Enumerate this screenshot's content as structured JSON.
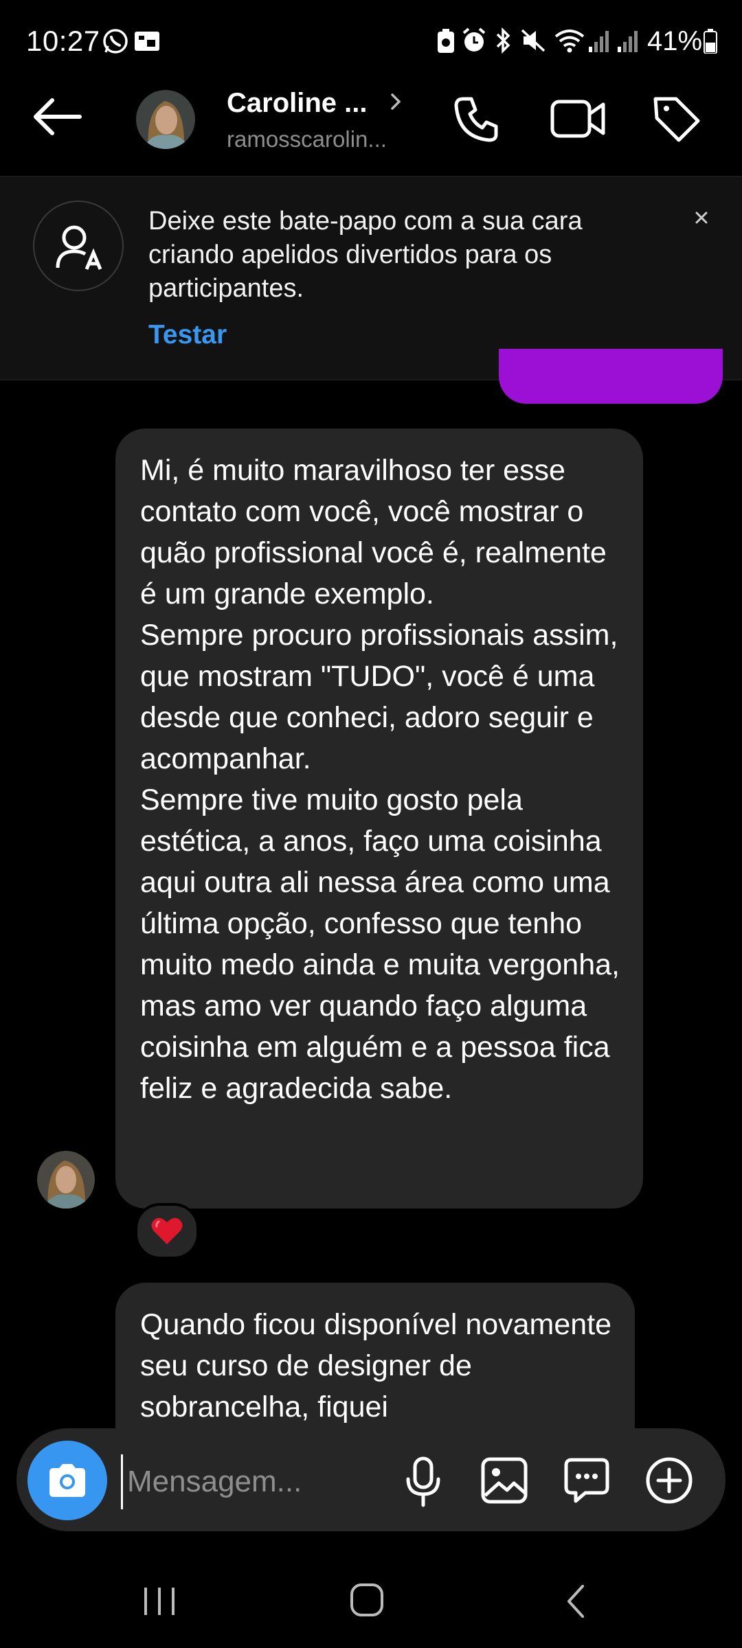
{
  "status_bar": {
    "time": "10:27",
    "battery": "41%",
    "icons": [
      "whatsapp-icon",
      "media-icon",
      "battery-saver-icon",
      "alarm-icon",
      "bluetooth-icon",
      "mute-icon",
      "wifi-icon",
      "signal-icon",
      "signal-icon",
      "battery-icon"
    ]
  },
  "header": {
    "contact_name": "Caroline ...",
    "contact_username": "ramosscarolin...",
    "icons": [
      "back-arrow-icon",
      "chevron-right-icon",
      "phone-icon",
      "video-call-icon",
      "tag-icon"
    ]
  },
  "banner": {
    "text": "Deixe este bate-papo com a sua cara criando apelidos divertidos para os participantes.",
    "action": "Testar",
    "icons": [
      "nickname-icon",
      "close-icon"
    ]
  },
  "messages": [
    {
      "sender": "contact",
      "text": "Mi, é muito maravilhoso ter esse contato com você, você mostrar o quão profissional você é, realmente é um grande exemplo.\nSempre procuro profissionais assim, que mostram \"TUDO\", você é uma desde que conheci, adoro seguir e acompanhar.\nSempre tive muito gosto pela estética, a anos, faço uma coisinha aqui outra ali nessa área como uma última opção, confesso que tenho muito medo ainda e muita vergonha, mas amo ver quando faço alguma coisinha em alguém e a pessoa fica feliz e agradecida sabe.",
      "reaction": "❤️"
    },
    {
      "sender": "contact",
      "text": "Quando ficou disponível novamente seu curso de designer de sobrancelha, fiquei"
    }
  ],
  "composer": {
    "placeholder": "Mensagem...",
    "icons": [
      "camera-icon",
      "microphone-icon",
      "gallery-icon",
      "sticker-icon",
      "add-icon"
    ]
  },
  "colors": {
    "accent_blue": "#3797f0",
    "sent_bubble": "#9b10d4",
    "received_bubble": "#262626",
    "reaction_heart": "#e0182d"
  },
  "nav_bar": {
    "icons": [
      "recent-apps-icon",
      "home-icon",
      "back-icon"
    ]
  }
}
